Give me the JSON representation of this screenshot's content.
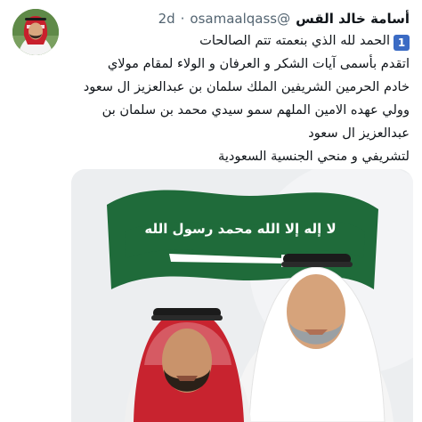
{
  "author": {
    "display_name": "أسامة خالد القس",
    "handle": "@osamaalqass",
    "separator": "·",
    "time": "2d"
  },
  "tweet": {
    "number_badge": "1",
    "lines": [
      "الحمد لله الذي بنعمته تتم الصالحات",
      "اتقدم بأسمى آيات الشكر و العرفان و الولاء لمقام مولاي",
      "خادم الحرمين الشريفين الملك سلمان بن عبدالعزيز ال سعود",
      "وولي عهده الامين الملهم سمو سيدي محمد بن سلمان بن",
      "عبدالعزيز ال سعود",
      "لتشريفي و منحي الجنسية السعودية"
    ]
  },
  "media": {
    "flag_text": "لا إله إلا الله محمد رسول الله",
    "colors": {
      "flag_green": "#1f6b3a",
      "shemagh_red": "#b8232f",
      "background": "#eceef0"
    }
  }
}
